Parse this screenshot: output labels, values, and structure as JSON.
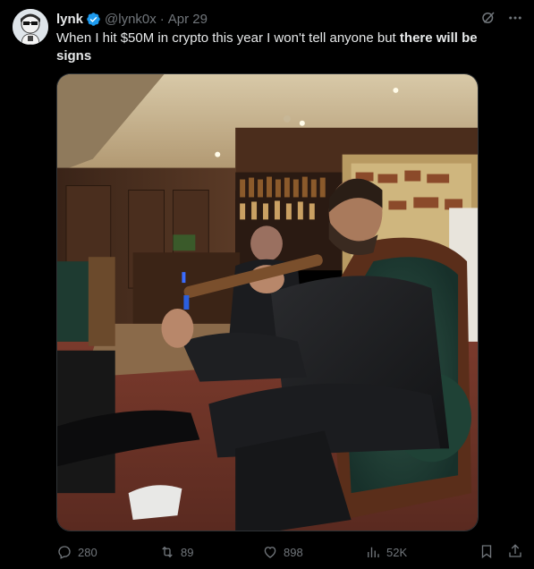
{
  "author": {
    "display_name": "lynk",
    "handle": "@lynk0x",
    "separator": "·",
    "date": "Apr 29"
  },
  "tweet": {
    "text_plain": "When I hit $50M in crypto this year I won't tell anyone but ",
    "text_bold": "there will be signs"
  },
  "metrics": {
    "replies": "280",
    "retweets": "89",
    "likes": "898",
    "views": "52K"
  },
  "colors": {
    "background": "#000000",
    "text": "#e7e9ea",
    "muted": "#71767b",
    "verified": "#1d9bf0",
    "border": "#2f3336"
  },
  "icons": {
    "verified": "verified-badge-icon",
    "grok": "grok-icon",
    "more": "more-icon",
    "reply": "reply-icon",
    "retweet": "retweet-icon",
    "like": "heart-icon",
    "views": "views-icon",
    "bookmark": "bookmark-icon",
    "share": "share-icon"
  }
}
